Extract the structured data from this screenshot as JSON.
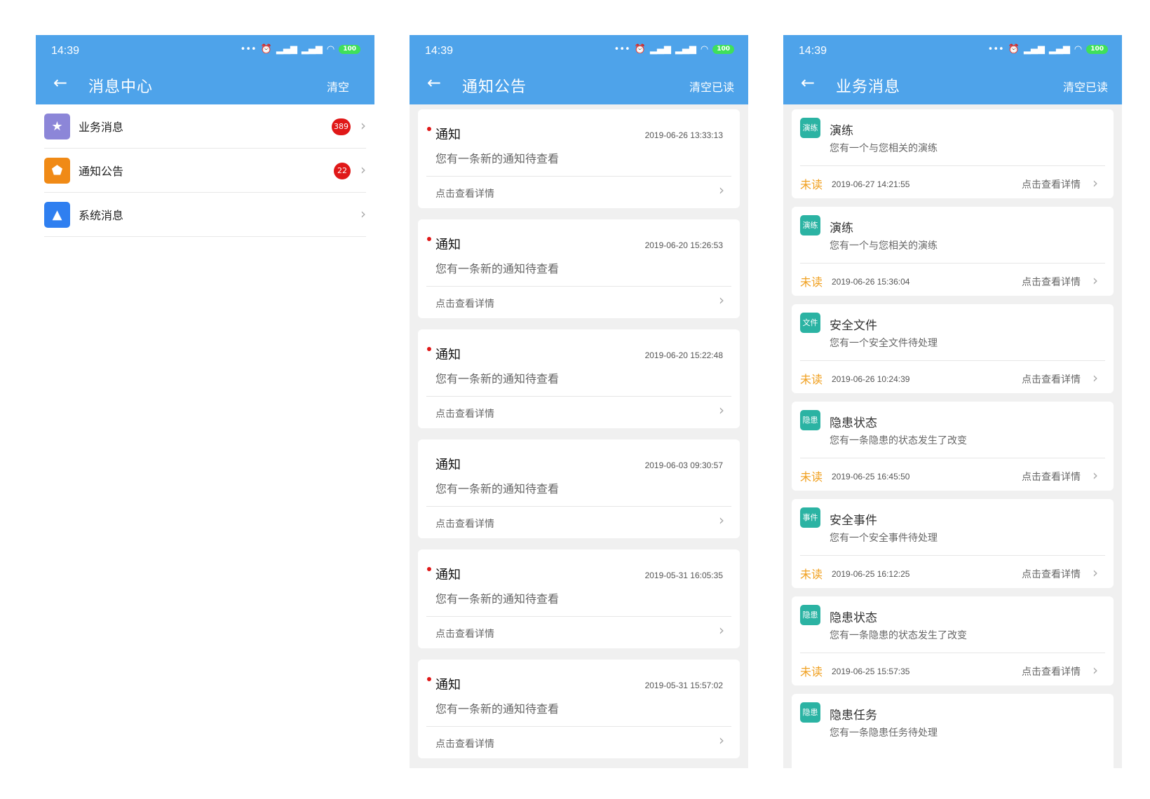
{
  "status_bar": {
    "time": "14:39",
    "battery": "100"
  },
  "colors": {
    "appbar": "#4ea3ea",
    "badge": "#e01818",
    "unread": "#f0a020",
    "biz_icon": "#2bb3a3"
  },
  "screen1": {
    "title": "消息中心",
    "action": "清空",
    "items": [
      {
        "label": "业务消息",
        "badge": "389",
        "icon": "star-icon",
        "icon_color": "#8c86d8"
      },
      {
        "label": "通知公告",
        "badge": "22",
        "icon": "pentagon-icon",
        "icon_color": "#f08a16"
      },
      {
        "label": "系统消息",
        "badge": "",
        "icon": "triangle-icon",
        "icon_color": "#2f7ff0"
      }
    ]
  },
  "screen2": {
    "title": "通知公告",
    "action": "清空已读",
    "notices": [
      {
        "title": "通知",
        "time": "2019-06-26 13:33:13",
        "body": "您有一条新的通知待查看",
        "link": "点击查看详情",
        "unread": true
      },
      {
        "title": "通知",
        "time": "2019-06-20 15:26:53",
        "body": "您有一条新的通知待查看",
        "link": "点击查看详情",
        "unread": true
      },
      {
        "title": "通知",
        "time": "2019-06-20 15:22:48",
        "body": "您有一条新的通知待查看",
        "link": "点击查看详情",
        "unread": true
      },
      {
        "title": "通知",
        "time": "2019-06-03 09:30:57",
        "body": "您有一条新的通知待查看",
        "link": "点击查看详情",
        "unread": false
      },
      {
        "title": "通知",
        "time": "2019-05-31 16:05:35",
        "body": "您有一条新的通知待查看",
        "link": "点击查看详情",
        "unread": true
      },
      {
        "title": "通知",
        "time": "2019-05-31 15:57:02",
        "body": "您有一条新的通知待查看",
        "link": "点击查看详情",
        "unread": true
      }
    ]
  },
  "screen3": {
    "title": "业务消息",
    "action": "清空已读",
    "messages": [
      {
        "tag": "演练",
        "title": "演练",
        "body": "您有一个与您相关的演练",
        "status": "未读",
        "time": "2019-06-27 14:21:55",
        "link": "点击查看详情"
      },
      {
        "tag": "演练",
        "title": "演练",
        "body": "您有一个与您相关的演练",
        "status": "未读",
        "time": "2019-06-26 15:36:04",
        "link": "点击查看详情"
      },
      {
        "tag": "文件",
        "title": "安全文件",
        "body": "您有一个安全文件待处理",
        "status": "未读",
        "time": "2019-06-26 10:24:39",
        "link": "点击查看详情"
      },
      {
        "tag": "隐患",
        "title": "隐患状态",
        "body": "您有一条隐患的状态发生了改变",
        "status": "未读",
        "time": "2019-06-25 16:45:50",
        "link": "点击查看详情"
      },
      {
        "tag": "事件",
        "title": "安全事件",
        "body": "您有一个安全事件待处理",
        "status": "未读",
        "time": "2019-06-25 16:12:25",
        "link": "点击查看详情"
      },
      {
        "tag": "隐患",
        "title": "隐患状态",
        "body": "您有一条隐患的状态发生了改变",
        "status": "未读",
        "time": "2019-06-25 15:57:35",
        "link": "点击查看详情"
      },
      {
        "tag": "隐患",
        "title": "隐患任务",
        "body": "您有一条隐患任务待处理",
        "status": "",
        "time": "",
        "link": ""
      }
    ]
  }
}
